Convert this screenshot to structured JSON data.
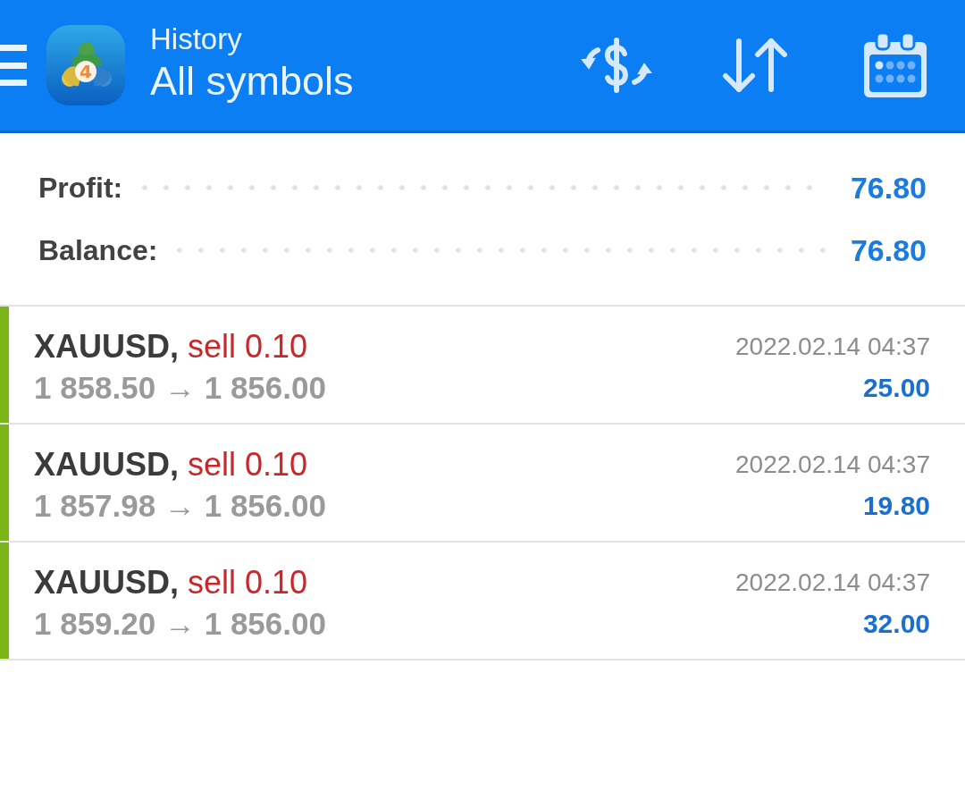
{
  "header": {
    "logo_mark": "4",
    "title": "History",
    "subtitle": "All symbols"
  },
  "summary": [
    {
      "label": "Profit:",
      "value": "76.80"
    },
    {
      "label": "Balance:",
      "value": "76.80"
    }
  ],
  "deals": [
    {
      "symbol": "XAUUSD,",
      "side": "sell",
      "volume": "0.10",
      "prices": "1 858.50 → 1 856.00",
      "time": "2022.02.14 04:37",
      "profit": "25.00",
      "profitable": true
    },
    {
      "symbol": "XAUUSD,",
      "side": "sell",
      "volume": "0.10",
      "prices": "1 857.98 → 1 856.00",
      "time": "2022.02.14 04:37",
      "profit": "19.80",
      "profitable": true
    },
    {
      "symbol": "XAUUSD,",
      "side": "sell",
      "volume": "0.10",
      "prices": "1 859.20 → 1 856.00",
      "time": "2022.02.14 04:37",
      "profit": "32.00",
      "profitable": true
    }
  ]
}
